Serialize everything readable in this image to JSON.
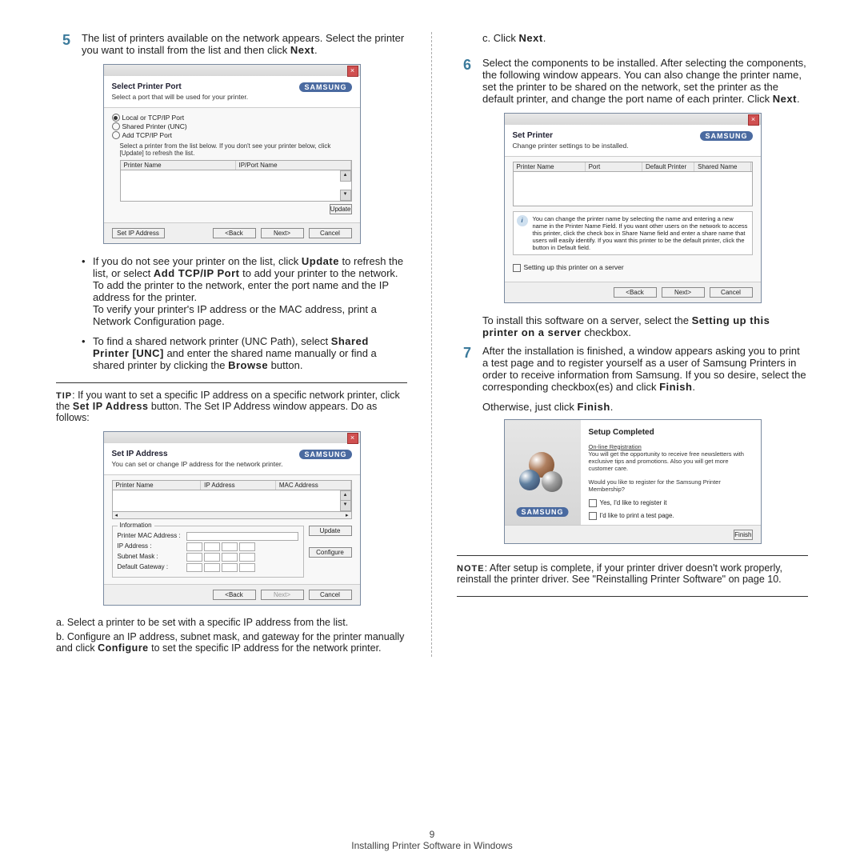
{
  "footer": {
    "page": "9",
    "title": "Installing Printer Software in Windows"
  },
  "left": {
    "step5": {
      "num": "5",
      "text": "The list of printers available on the network appears. Select the printer you want to install from the list and then click ",
      "bold": "Next",
      "tail": "."
    },
    "bul1": {
      "t1": "If you do not see your printer on the list, click ",
      "b1": "Update",
      "t2": " to refresh the list, or select ",
      "b2": "Add TCP/IP Port",
      "t3": " to add your printer to the network. To add the printer to the network, enter the port name and the IP address for the printer.",
      "t4": "To verify your printer's IP address or the MAC address, print a Network Configuration page."
    },
    "bul2": {
      "t1": "To find a shared network printer (UNC Path), select ",
      "b1": "Shared Printer [UNC]",
      "t2": " and enter the shared name manually or find a shared printer by clicking the ",
      "b2": "Browse",
      "t3": " button."
    },
    "tip": {
      "label": "TIP",
      "text": ": If you want to set a specific IP address on a specific network printer, click the ",
      "b": "Set IP Address",
      "tail": " button. The Set IP Address window appears. Do as follows:"
    },
    "subA": "a. Select a printer to be set with a specific IP address from the list.",
    "subB": {
      "t1": "b. Configure an IP address, subnet mask, and gateway for the printer manually and click ",
      "b": "Configure",
      "t2": " to set the specific IP address for the network printer."
    }
  },
  "right": {
    "subC": {
      "t1": "c. Click ",
      "b": "Next",
      "t2": "."
    },
    "step6": {
      "num": "6",
      "t": "Select the components to be installed. After selecting the components, the following window appears. You can also change the printer name, set the printer to be shared on the network, set the printer as the default printer, and change the port name of each printer. Click ",
      "b": "Next",
      "tail": "."
    },
    "afterSet": {
      "t1": "To install this software on a server, select the ",
      "b": "Setting up this printer on a server",
      "t2": " checkbox."
    },
    "step7": {
      "num": "7",
      "t": "After the installation is finished, a window appears asking you to print a test page and to register yourself as a user of Samsung Printers in order to receive information from Samsung. If you so desire, select the corresponding checkbox(es) and click ",
      "b": "Finish",
      "tail": "."
    },
    "otherwise": {
      "t1": "Otherwise, just click ",
      "b": "Finish",
      "t2": "."
    },
    "note": {
      "label": "NOTE",
      "text": ": After setup is complete, if your printer driver doesn't work properly, reinstall the printer driver. See \"Reinstalling Printer Software\" on page 10."
    }
  },
  "dlg1": {
    "title": "Select Printer Port",
    "sub": "Select a port that will be used for your printer.",
    "brand": "SAMSUNG",
    "r1": "Local or TCP/IP Port",
    "r2": "Shared Printer (UNC)",
    "r3": "Add TCP/IP Port",
    "hint": "Select a printer from the list below. If you don't see your printer below, click [Update] to refresh the list.",
    "h1": "Printer Name",
    "h2": "IP/Port Name",
    "update": "Update",
    "setip": "Set IP Address",
    "back": "<Back",
    "next": "Next>",
    "cancel": "Cancel"
  },
  "dlg2": {
    "title": "Set IP Address",
    "sub": "You can set or change IP address for the network printer.",
    "brand": "SAMSUNG",
    "h1": "Printer Name",
    "h2": "IP Address",
    "h3": "MAC Address",
    "leg": "Information",
    "f1": "Printer MAC Address :",
    "f2": "IP Address :",
    "f3": "Subnet Mask :",
    "f4": "Default Gateway :",
    "update": "Update",
    "configure": "Configure",
    "back": "<Back",
    "next": "Next>",
    "cancel": "Cancel"
  },
  "dlg3": {
    "title": "Set Printer",
    "sub": "Change printer settings to be installed.",
    "brand": "SAMSUNG",
    "h1": "Printer Name",
    "h2": "Port",
    "h3": "Default Printer",
    "h4": "Shared Name",
    "info": "You can change the printer name by selecting the name and entering a new name in the Printer Name Field. If you want other users on the network to access this printer, click the check box in Share Name field and enter a share name that users will easily identify. If you want this printer to be the default printer, click the button in Default field.",
    "chk": "Setting up this printer on a server",
    "back": "<Back",
    "next": "Next>",
    "cancel": "Cancel"
  },
  "dlg4": {
    "title": "Setup Completed",
    "reg_h": "On-line Registration",
    "reg": "You will get the opportunity to receive free newsletters with exclusive tips and promotions. Also you will get more customer care.",
    "q": "Would you like to register for the Samsung Printer Membership?",
    "c1": "Yes, I'd like to register it",
    "c2": "I'd like to print a test page.",
    "brand": "SAMSUNG",
    "finish": "Finish"
  }
}
